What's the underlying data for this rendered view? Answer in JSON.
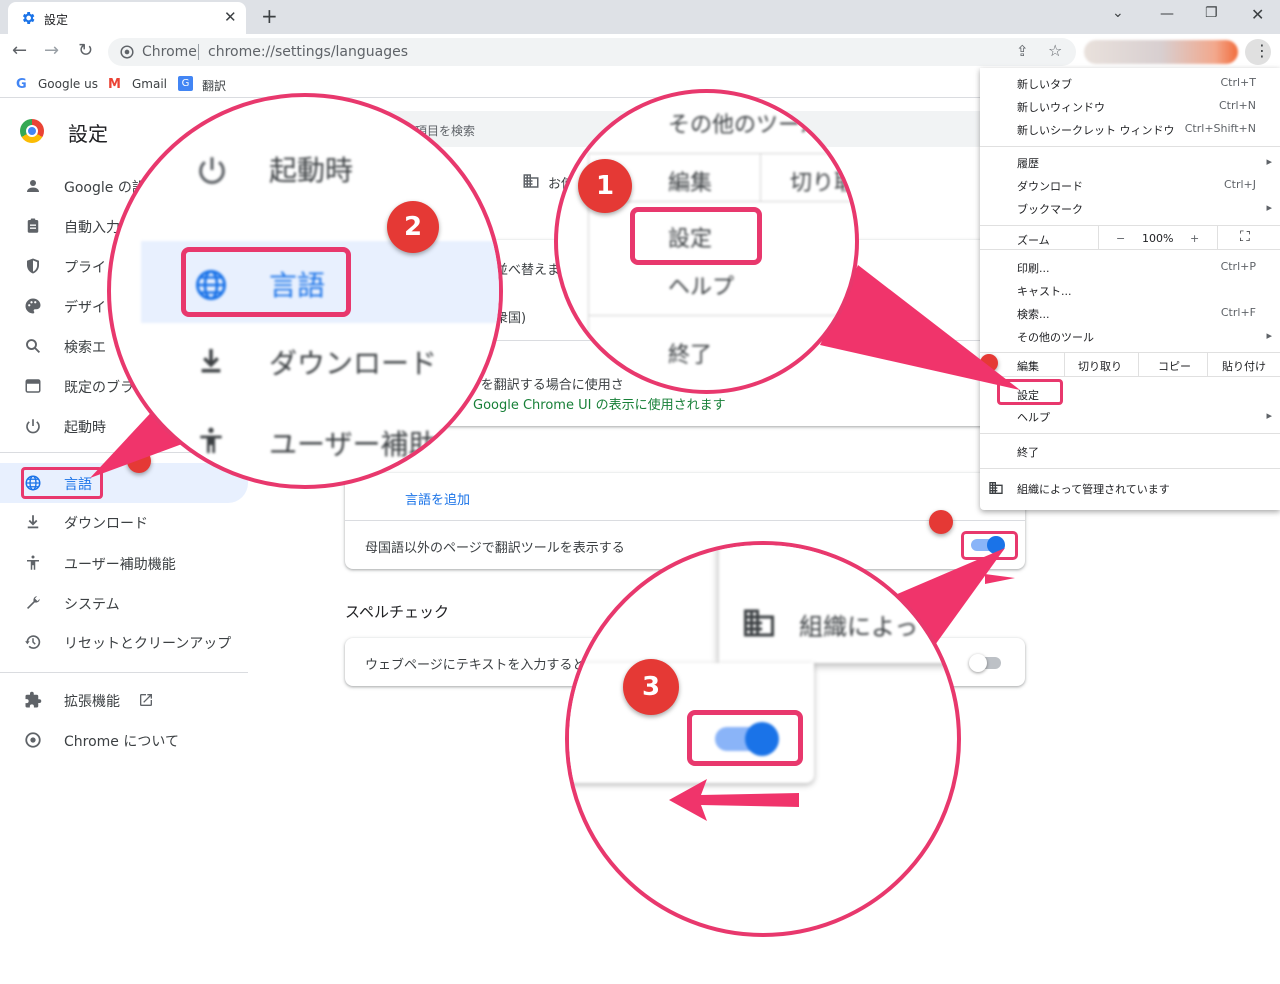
{
  "browser": {
    "tab_title": "設定",
    "omnibox_chrome": "Chrome",
    "omnibox_url": "chrome://settings/languages",
    "bookmarks": [
      "Google us",
      "Gmail",
      "翻訳"
    ]
  },
  "settings": {
    "title": "設定",
    "search_placeholder": "項目を検索",
    "sidebar": [
      {
        "label": "Google の設",
        "icon": "person-icon"
      },
      {
        "label": "自動入力",
        "icon": "clipboard-icon"
      },
      {
        "label": "プライ",
        "icon": "shield-icon"
      },
      {
        "label": "デザイ",
        "icon": "palette-icon"
      },
      {
        "label": "検索エ",
        "icon": "search-icon"
      },
      {
        "label": "既定のブラ",
        "icon": "browser-icon"
      },
      {
        "label": "起動時",
        "icon": "power-icon"
      },
      {
        "label": "言語",
        "icon": "globe-icon"
      },
      {
        "label": "ダウンロード",
        "icon": "download-icon"
      },
      {
        "label": "ユーザー補助機能",
        "icon": "accessibility-icon"
      },
      {
        "label": "システム",
        "icon": "wrench-icon"
      },
      {
        "label": "リセットとクリーンアップ",
        "icon": "history-icon"
      },
      {
        "label": "拡張機能",
        "icon": "puzzle-icon"
      },
      {
        "label": "Chrome について",
        "icon": "chrome-icon"
      }
    ],
    "managed_fragment": "お使",
    "row_fragment_1": "並べ替えます",
    "row_fragment_2": "衆国)",
    "row_fragment_3": "ージを翻訳する場合に使用さ",
    "row_fragment_4": "Google Chrome UI の表示に使用されます",
    "add_language": "言語を追加",
    "translate_toggle_label": "母国語以外のページで翻訳ツールを表示する",
    "spellcheck_heading": "スペルチェック",
    "spellcheck_label": "ウェブページにテキストを入力すると"
  },
  "chrome_menu": {
    "items": [
      {
        "label": "新しいタブ",
        "shortcut": "Ctrl+T"
      },
      {
        "label": "新しいウィンドウ",
        "shortcut": "Ctrl+N"
      },
      {
        "label": "新しいシークレット ウィンドウ",
        "shortcut": "Ctrl+Shift+N"
      },
      {
        "label": "履歴",
        "shortcut": ""
      },
      {
        "label": "ダウンロード",
        "shortcut": "Ctrl+J"
      },
      {
        "label": "ブックマーク",
        "shortcut": ""
      },
      {
        "label": "印刷...",
        "shortcut": "Ctrl+P"
      },
      {
        "label": "キャスト...",
        "shortcut": ""
      },
      {
        "label": "検索...",
        "shortcut": "Ctrl+F"
      },
      {
        "label": "その他のツール",
        "shortcut": ""
      }
    ],
    "zoom_label": "ズーム",
    "zoom_minus": "−",
    "zoom_value": "100%",
    "zoom_plus": "+",
    "edit_label": "編集",
    "cut_label": "切り取り",
    "copy_label": "コピー",
    "paste_label": "貼り付け",
    "settings_label": "設定",
    "help_label": "ヘルプ",
    "exit_label": "終了",
    "managed_label": "組織によって管理されています"
  },
  "zoom1": {
    "more_tools": "その他のツール",
    "edit": "編集",
    "cut": "切り取",
    "settings": "設定",
    "help": "ヘルプ",
    "exit": "終了"
  },
  "zoom2": {
    "startup": "起動時",
    "language": "言語",
    "download": "ダウンロード",
    "accessibility": "ユーザー補助機"
  },
  "zoom3": {
    "managed": "組織によって"
  },
  "badges": {
    "step1": "1",
    "step2": "2",
    "step3": "3"
  },
  "colors": {
    "accent": "#1a73e8",
    "highlight": "#e8386d",
    "badge": "#e53935"
  }
}
